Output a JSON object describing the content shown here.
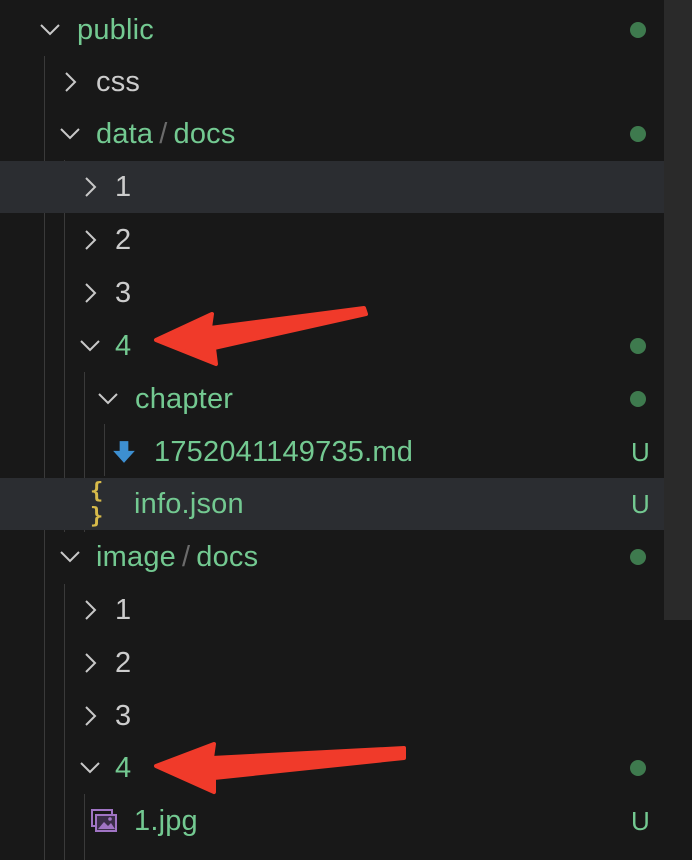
{
  "explorer": {
    "rows": [
      {
        "label": "public",
        "color": "green",
        "status": "dot"
      },
      {
        "label": "css",
        "color": "white",
        "status": ""
      },
      {
        "label_a": "data",
        "label_b": "docs",
        "color": "green",
        "status": "dot"
      },
      {
        "label": "1",
        "color": "white",
        "status": ""
      },
      {
        "label": "2",
        "color": "white",
        "status": ""
      },
      {
        "label": "3",
        "color": "white",
        "status": ""
      },
      {
        "label": "4",
        "color": "green",
        "status": "dot"
      },
      {
        "label": "chapter",
        "color": "green",
        "status": "dot"
      },
      {
        "label": "1752041149735.md",
        "color": "green",
        "status": "U",
        "icon": "markdown-arrow-icon"
      },
      {
        "label": "info.json",
        "color": "green",
        "status": "U",
        "icon": "json-braces-icon",
        "icon_text": "{ }"
      },
      {
        "label_a": "image",
        "label_b": "docs",
        "color": "green",
        "status": "dot"
      },
      {
        "label": "1",
        "color": "white",
        "status": ""
      },
      {
        "label": "2",
        "color": "white",
        "status": ""
      },
      {
        "label": "3",
        "color": "white",
        "status": ""
      },
      {
        "label": "4",
        "color": "green",
        "status": "dot"
      },
      {
        "label": "1.jpg",
        "color": "green",
        "status": "U",
        "icon": "image-file-icon"
      }
    ],
    "separator": "/",
    "untracked_badge": "U"
  },
  "colors": {
    "background": "#181818",
    "git_untracked": "#73c991",
    "annotation_arrow": "#f03a2a",
    "selected_row": "#2b2d31"
  }
}
